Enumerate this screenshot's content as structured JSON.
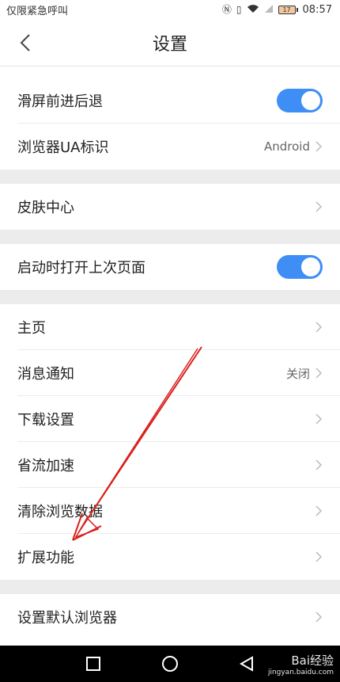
{
  "status_bar": {
    "carrier": "仅限紧急呼叫",
    "battery": "17",
    "time": "08:57"
  },
  "header": {
    "title": "设置",
    "back_icon": "chevron-left-icon"
  },
  "settings": {
    "swipe_nav": {
      "label": "滑屏前进后退",
      "enabled": true
    },
    "ua": {
      "label": "浏览器UA标识",
      "value": "Android"
    },
    "skin": {
      "label": "皮肤中心"
    },
    "restore": {
      "label": "启动时打开上次页面",
      "enabled": true
    },
    "homepage": {
      "label": "主页"
    },
    "notifications": {
      "label": "消息通知",
      "value": "关闭"
    },
    "download": {
      "label": "下载设置"
    },
    "data_saver": {
      "label": "省流加速"
    },
    "clear_data": {
      "label": "清除浏览数据"
    },
    "extensions": {
      "label": "扩展功能"
    },
    "default_browser": {
      "label": "设置默认浏览器"
    }
  },
  "watermark": {
    "brand": "Bai经验",
    "url": "jingyan.baidu.com"
  },
  "colors": {
    "toggle_on": "#3f8ef5",
    "section_gap": "#ececec",
    "annotation_arrow": "#d9211e"
  }
}
